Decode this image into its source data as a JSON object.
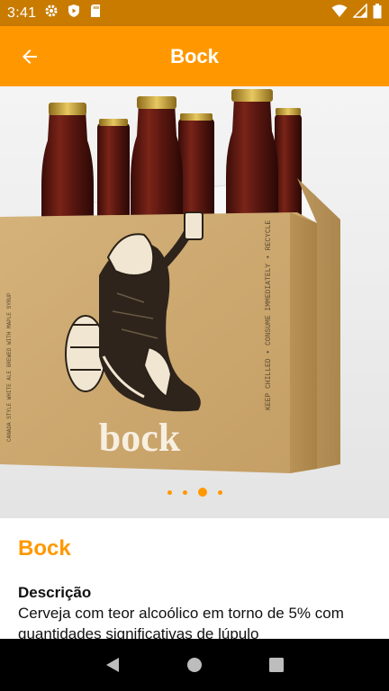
{
  "status_bar": {
    "time": "3:41",
    "left_icons": [
      "gear-icon",
      "shield-play-icon",
      "sd-card-icon"
    ],
    "right_icons": [
      "wifi-icon",
      "cellular-signal-icon",
      "battery-icon"
    ]
  },
  "app_bar": {
    "title": "Bock",
    "back_icon": "arrow-left-icon",
    "color": "#ff9800"
  },
  "carousel": {
    "image_label": "bock",
    "side_text": "KEEP CHILLED • CONSUME IMMEDIATELY • RECYCLE",
    "side_text_2": "CANADA STYLE WHITE ALE BREWED WITH MAPLE SYRUP",
    "page_count": 4,
    "active_index": 2
  },
  "product": {
    "name": "Bock",
    "description_label": "Descrição",
    "description": "Cerveja com teor alcoólico em torno de 5% com quantidades significativas de lúpulo"
  },
  "nav_bar": {
    "back": "triangle-back-icon",
    "home": "circle-home-icon",
    "recents": "square-recents-icon"
  }
}
